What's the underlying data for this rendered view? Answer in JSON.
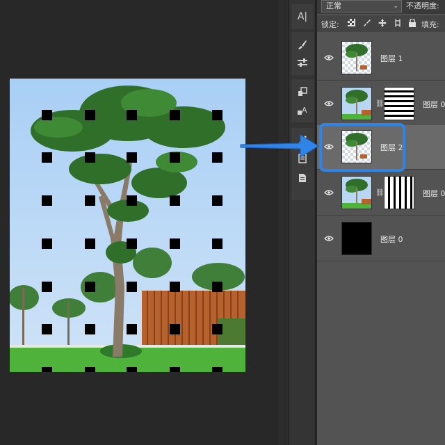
{
  "colors": {
    "accent": "#2f84e8",
    "panel": "#535353",
    "selected_row": "#6a6a6a"
  },
  "options_bar": {
    "blend_mode": "正常",
    "opacity_label": "不透明度:"
  },
  "lock_bar": {
    "lock_label": "锁定:",
    "fill_label": "填充:"
  },
  "layers": [
    {
      "name": "图层 1",
      "thumb": "checker-tree",
      "mask": null,
      "selected": false
    },
    {
      "name": "图层 0",
      "thumb": "tree",
      "mask": "horizontal-stripes",
      "selected": false
    },
    {
      "name": "图层 2",
      "thumb": "checker-tree",
      "mask": null,
      "selected": true
    },
    {
      "name": "图层 0",
      "thumb": "tree",
      "mask": "vertical-stripes",
      "selected": false
    },
    {
      "name": "图层 0",
      "thumb": "black",
      "mask": null,
      "selected": false
    }
  ],
  "tools": [
    "text-icon",
    "brush-icon",
    "adjust-icon",
    "clone-icon",
    "text-warp-icon",
    "pen-icon",
    "notes-icon",
    "document-icon"
  ],
  "annotation": {
    "icon": "arrow-right-icon"
  }
}
